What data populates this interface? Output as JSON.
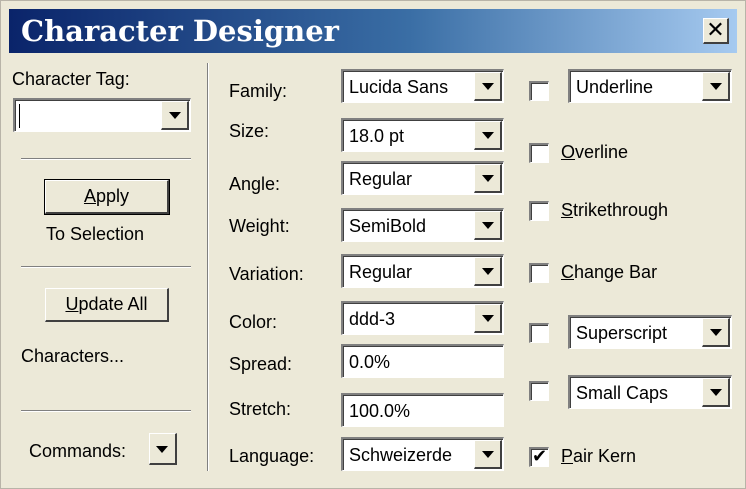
{
  "window": {
    "title": "Character Designer",
    "close_symbol": "✕"
  },
  "left": {
    "character_tag_label": "Character Tag:",
    "character_tag_value": "",
    "apply": {
      "mnemonic": "A",
      "rest": "pply"
    },
    "to_selection": "To Selection",
    "update_all": {
      "mnemonic": "U",
      "rest": "pdate All"
    },
    "characters": "Characters...",
    "commands_label": "Commands:"
  },
  "properties": {
    "family_label": "Family:",
    "family_value": "Lucida Sans",
    "size_label": "Size:",
    "size_value": "18.0 pt",
    "angle_label": "Angle:",
    "angle_value": "Regular",
    "weight_label": "Weight:",
    "weight_value": "SemiBold",
    "variation_label": "Variation:",
    "variation_value": "Regular",
    "color_label": "Color:",
    "color_value": "ddd-3",
    "spread_label": "Spread:",
    "spread_value": "0.0%",
    "stretch_label": "Stretch:",
    "stretch_value": "100.0%",
    "language_label": "Language:",
    "language_value": "Schweizerde"
  },
  "effects": {
    "underline": {
      "value": "Underline",
      "checked": false
    },
    "overline": {
      "mnemonic": "O",
      "rest": "verline",
      "checked": false
    },
    "strikethrough": {
      "mnemonic": "S",
      "rest": "trikethrough",
      "checked": false
    },
    "change_bar": {
      "mnemonic": "C",
      "rest": "hange Bar",
      "checked": false
    },
    "superscript": {
      "value": "Superscript",
      "checked": false
    },
    "small_caps": {
      "value": "Small Caps",
      "checked": false
    },
    "pair_kern": {
      "mnemonic": "P",
      "rest": "air Kern",
      "checked": true,
      "check_symbol": "✔"
    }
  },
  "icons": {
    "dropdown": "triangle-down",
    "close": "x-mark"
  }
}
